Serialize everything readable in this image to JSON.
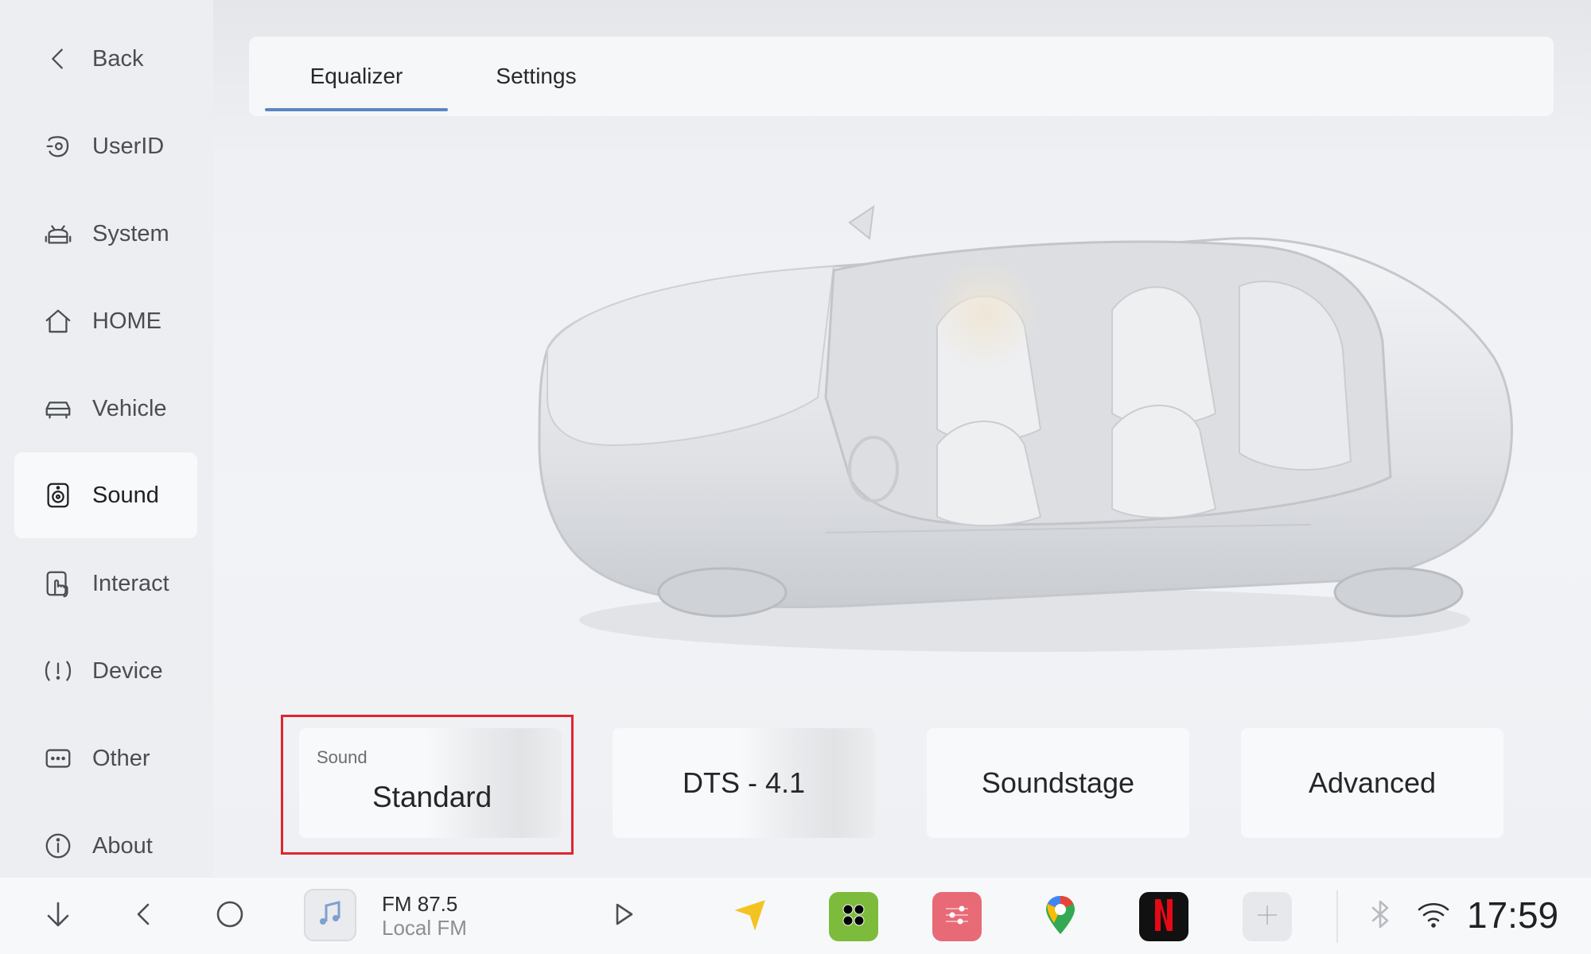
{
  "sidebar": {
    "items": [
      {
        "label": "Back",
        "icon": "chevron-left-icon"
      },
      {
        "label": "UserID",
        "icon": "userid-icon"
      },
      {
        "label": "System",
        "icon": "android-icon"
      },
      {
        "label": "HOME",
        "icon": "home-icon"
      },
      {
        "label": "Vehicle",
        "icon": "car-icon"
      },
      {
        "label": "Sound",
        "icon": "speaker-icon",
        "active": true
      },
      {
        "label": "Interact",
        "icon": "touch-icon"
      },
      {
        "label": "Device",
        "icon": "alert-icon"
      },
      {
        "label": "Other",
        "icon": "more-icon"
      },
      {
        "label": "About",
        "icon": "info-icon"
      }
    ]
  },
  "tabs": [
    {
      "label": "Equalizer",
      "active": true
    },
    {
      "label": "Settings"
    }
  ],
  "modes": {
    "standard": {
      "small": "Sound",
      "label": "Standard"
    },
    "dts": {
      "label": "DTS - 4.1"
    },
    "soundstage": {
      "label": "Soundstage"
    },
    "advanced": {
      "label": "Advanced"
    }
  },
  "media": {
    "title": "FM 87.5",
    "subtitle": "Local FM"
  },
  "status": {
    "time": "17:59"
  },
  "colors": {
    "accent": "#5a86c4",
    "highlight": "#e02530",
    "apps_green": "#7dbb3c",
    "apps_pink": "#e86a77",
    "netflix": "#e50914"
  }
}
